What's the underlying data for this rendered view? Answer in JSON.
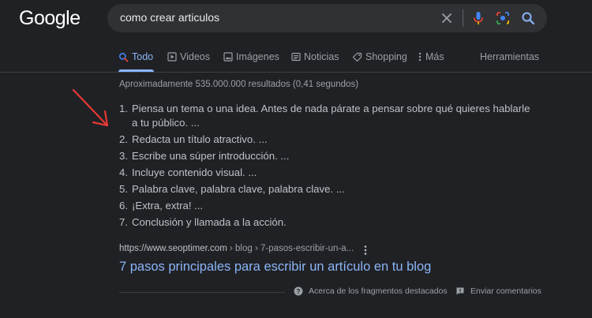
{
  "logo": {
    "text": "Google"
  },
  "search": {
    "query": "como crear articulos",
    "icons": [
      "clear-icon",
      "microphone-icon",
      "camera-lens-icon",
      "search-icon"
    ]
  },
  "tabs": [
    {
      "label": "Todo",
      "icon": "search-icon",
      "active": true
    },
    {
      "label": "Videos",
      "icon": "video-icon",
      "active": false
    },
    {
      "label": "Imágenes",
      "icon": "image-icon",
      "active": false
    },
    {
      "label": "Noticias",
      "icon": "news-icon",
      "active": false
    },
    {
      "label": "Shopping",
      "icon": "tag-icon",
      "active": false
    },
    {
      "label": "Más",
      "icon": "kebab-icon",
      "active": false
    }
  ],
  "tools_label": "Herramientas",
  "result_stats": "Aproximadamente 535.000.000 resultados (0,41 segundos)",
  "snippet": {
    "steps": [
      {
        "num": "1.",
        "text": "Piensa un tema o una idea. Antes de nada párate a pensar sobre qué quieres hablarle a tu público. ..."
      },
      {
        "num": "2.",
        "text": "Redacta un título atractivo. ..."
      },
      {
        "num": "3.",
        "text": "Escribe una súper introducción. ..."
      },
      {
        "num": "4.",
        "text": "Incluye contenido visual. ..."
      },
      {
        "num": "5.",
        "text": "Palabra clave, palabra clave, palabra clave. ..."
      },
      {
        "num": "6.",
        "text": "¡Extra, extra! ..."
      },
      {
        "num": "7.",
        "text": "Conclusión y llamada a la acción."
      }
    ]
  },
  "result": {
    "domain": "https://www.seoptimer.com",
    "path": " › blog › 7-pasos-escribir-un-a...",
    "title": "7 pasos principales para escribir un artículo en tu blog"
  },
  "footer": {
    "about_label": "Acerca de los fragmentos destacados",
    "feedback_label": "Enviar comentarios"
  },
  "colors": {
    "background": "#202124",
    "link": "#8ab4f8",
    "annotation_arrow": "#e53935"
  }
}
